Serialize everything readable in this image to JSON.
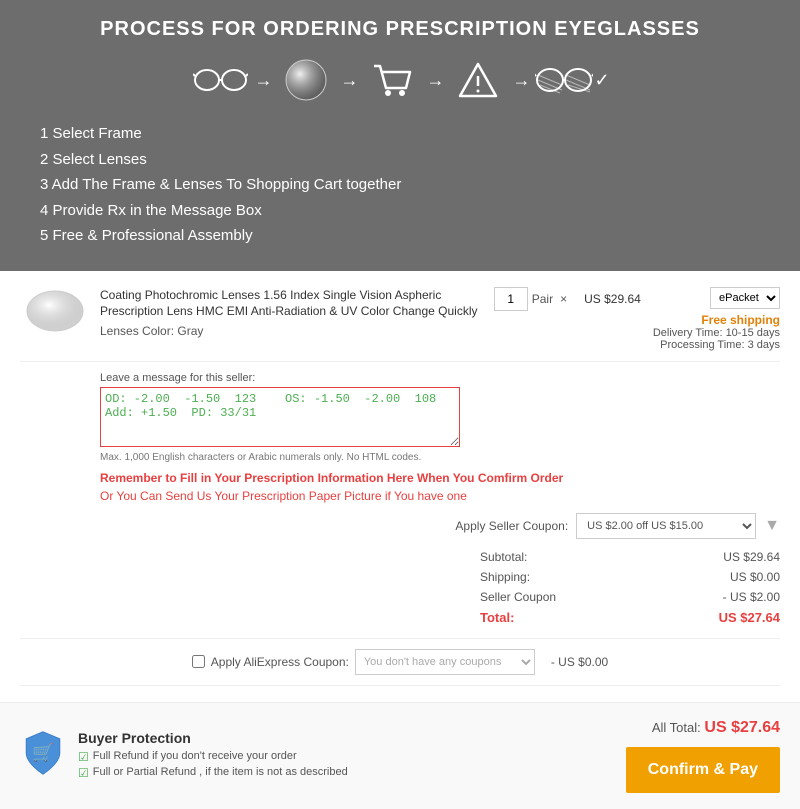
{
  "header": {
    "title": "PROCESS FOR ORDERING PRESCRIPTION EYEGLASSES",
    "steps": [
      "1 Select Frame",
      "2 Select Lenses",
      "3 Add The Frame & Lenses To Shopping Cart together",
      "4 Provide Rx in the Message Box",
      "5 Free & Professional Assembly"
    ]
  },
  "cart": {
    "product_title": "Coating Photochromic Lenses 1.56 Index Single Vision Aspheric Prescription Lens HMC EMI Anti-Radiation & UV Color Change Quickly",
    "lens_color_label": "Lenses Color:",
    "lens_color": "Gray",
    "quantity": "1",
    "qty_unit": "Pair",
    "price": "US $29.64",
    "shipping_option": "ePacket",
    "free_shipping": "Free shipping",
    "delivery_time": "Delivery Time: 10-15 days",
    "processing_time": "Processing Time: 3 days",
    "message_label": "Leave a message for this seller:",
    "message_content": "OD: -2.00  -1.50  123    OS: -1.50  -2.00  108   Add: +1.50  PD: 33/31",
    "message_hint": "Max. 1,000 English characters or Arabic numerals only. No HTML codes.",
    "rx_warning": "Remember to Fill in Your Prescription Information Here When You Comfirm Order",
    "rx_alt": "Or You Can Send Us Your Prescription Paper Picture if You have one"
  },
  "coupon": {
    "label": "Apply Seller Coupon:",
    "value": "US $2.00 off US $15.00"
  },
  "summary": {
    "subtotal_label": "Subtotal:",
    "subtotal_value": "US $29.64",
    "shipping_label": "Shipping:",
    "shipping_value": "US $0.00",
    "seller_coupon_label": "Seller Coupon",
    "seller_coupon_value": "- US $2.00",
    "total_label": "Total:",
    "total_value": "US $27.64"
  },
  "ali_coupon": {
    "label": "Apply AliExpress Coupon:",
    "placeholder": "You don't have any coupons",
    "amount": "- US $0.00"
  },
  "footer": {
    "protection_title": "Buyer Protection",
    "protection_items": [
      "Full Refund if you don't receive your order",
      "Full or Partial Refund , if the item is not as described"
    ],
    "all_total_label": "All Total:",
    "all_total_value": "US $27.64",
    "confirm_label": "Confirm & Pay"
  }
}
